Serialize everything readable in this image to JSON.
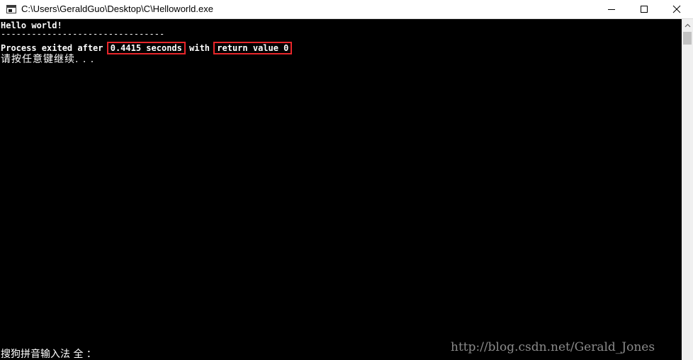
{
  "window": {
    "title": "C:\\Users\\GeraldGuo\\Desktop\\C\\Helloworld.exe",
    "controls": [
      "minimize",
      "maximize",
      "close"
    ]
  },
  "console": {
    "line1": "Hello world!",
    "line2": "--------------------------------",
    "line3_prefix": "Process exited after",
    "line3_time": "0.4415 seconds",
    "line3_mid": "with",
    "line3_return": "return value 0",
    "line4": "请按任意键继续. . .",
    "highlight_color": "#e8262a"
  },
  "ime": {
    "status": "搜狗拼音输入法 全 ："
  },
  "watermark": {
    "text": "http://blog.csdn.net/Gerald_Jones"
  },
  "colors": {
    "background": "#000000",
    "text": "#ffffff",
    "titlebar": "#ffffff"
  }
}
